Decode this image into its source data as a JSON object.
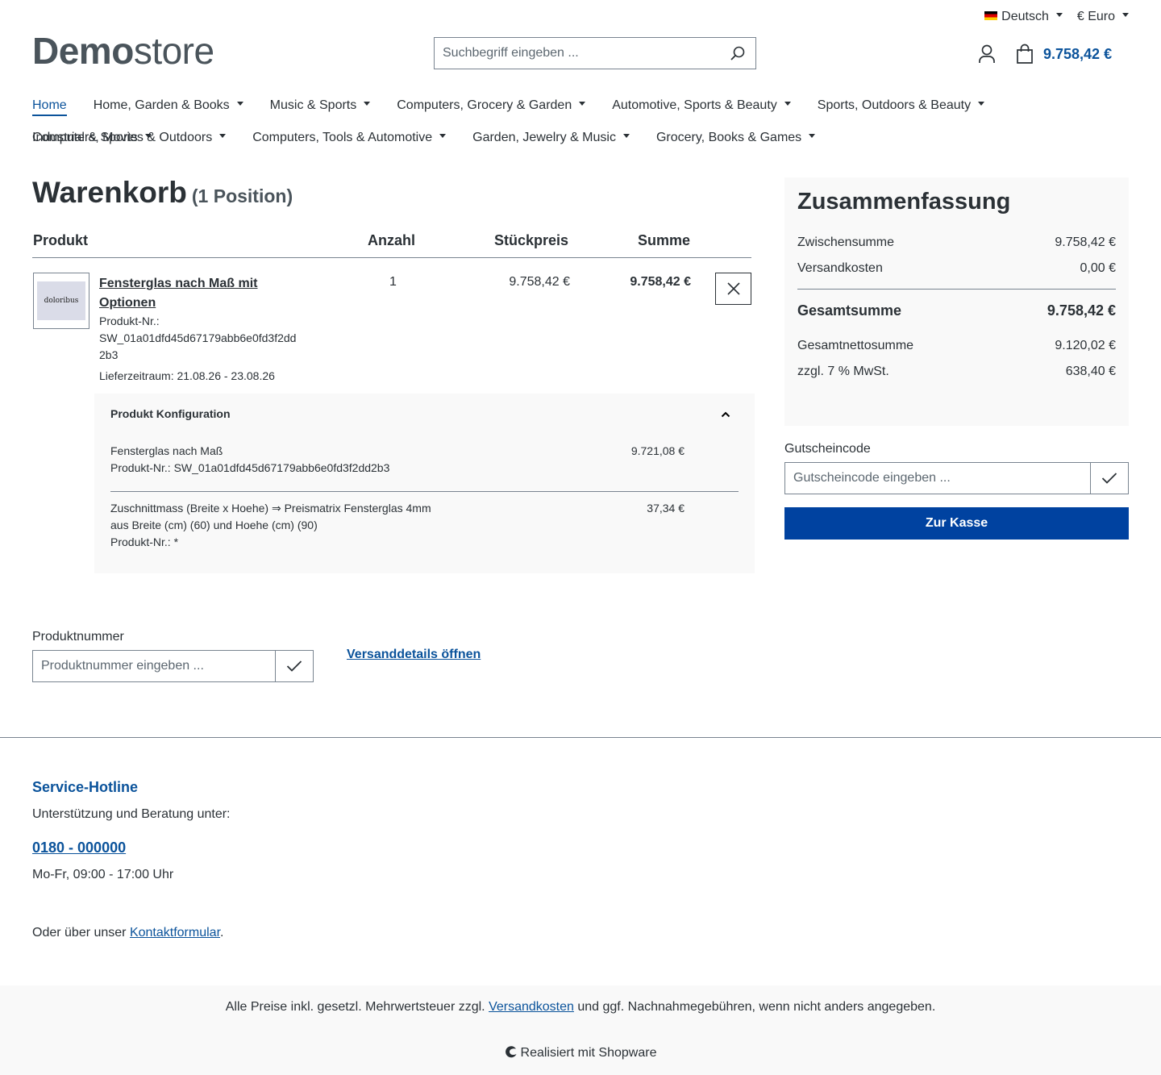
{
  "topbar": {
    "language": "Deutsch",
    "currency": "€ Euro"
  },
  "header": {
    "logo_bold": "Demo",
    "logo_light": "store",
    "search_placeholder": "Suchbegriff eingeben ...",
    "cart_total": "9.758,42 €"
  },
  "nav": {
    "items": [
      "Home",
      "Home, Garden & Books",
      "Music & Sports",
      "Computers, Grocery & Garden",
      "Automotive, Sports & Beauty",
      "Sports, Outdoors & Beauty",
      "Industrial & Sports",
      "Computers, Movies & Outdoors",
      "Computers, Tools & Automotive",
      "Garden, Jewelry & Music",
      "Grocery, Books & Games"
    ]
  },
  "cart": {
    "title": "Warenkorb",
    "count": "(1 Position)",
    "columns": {
      "product": "Produkt",
      "qty": "Anzahl",
      "unit": "Stückpreis",
      "sum": "Summe"
    },
    "item": {
      "thumb_text": "doloribus",
      "name": "Fensterglas nach Maß mit Optionen",
      "number_label": "Produkt-Nr.:",
      "number": "SW_01a01dfd45d67179abb6e0fd3f2dd2b3",
      "delivery": "Lieferzeitraum: 21.08.26 - 23.08.26",
      "qty": "1",
      "unit_price": "9.758,42 €",
      "sum": "9.758,42 €"
    },
    "config": {
      "title": "Produkt Konfiguration",
      "rows": [
        {
          "line1": "Fensterglas nach Maß",
          "line2": "Produkt-Nr.: SW_01a01dfd45d67179abb6e0fd3f2dd2b3",
          "line3": "",
          "price": "9.721,08 €"
        },
        {
          "line1": "Zuschnittmass (Breite x Hoehe) ⇒ Preismatrix Fensterglas 4mm",
          "line2": "aus Breite (cm) (60) und Hoehe (cm) (90)",
          "line3": "Produkt-Nr.: *",
          "price": "37,34 €"
        }
      ]
    }
  },
  "summary": {
    "title": "Zusammenfassung",
    "subtotal_label": "Zwischensumme",
    "subtotal": "9.758,42 €",
    "shipping_label": "Versandkosten",
    "shipping": "0,00 €",
    "total_label": "Gesamtsumme",
    "total": "9.758,42 €",
    "net_label": "Gesamtnettosumme",
    "net": "9.120,02 €",
    "tax_label": "zzgl. 7 % MwSt.",
    "tax": "638,40 €"
  },
  "voucher": {
    "label": "Gutscheincode",
    "placeholder": "Gutscheincode eingeben ..."
  },
  "checkout_label": "Zur Kasse",
  "product_number": {
    "label": "Produktnummer",
    "placeholder": "Produktnummer eingeben ..."
  },
  "shipping_details": "Versanddetails öffnen",
  "footer": {
    "hotline_title": "Service-Hotline",
    "hotline_sub": "Unterstützung und Beratung unter:",
    "phone": "0180 - 000000",
    "hours": "Mo-Fr, 09:00 - 17:00 Uhr",
    "contact_pre": "Oder über unser ",
    "contact_link": "Kontaktformular",
    "contact_post": ".",
    "vat_pre": "Alle Preise inkl. gesetzl. Mehrwertsteuer zzgl. ",
    "vat_link": "Versandkosten",
    "vat_post": " und ggf. Nachnahmegebühren, wenn nicht anders angegeben.",
    "powered": "Realisiert mit Shopware"
  }
}
